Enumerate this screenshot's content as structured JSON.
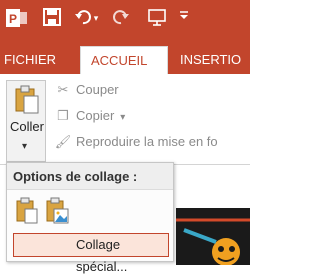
{
  "titlebar": {
    "app_logo_icon": "powerpoint-logo-icon",
    "save_icon": "save-icon",
    "undo_icon": "undo-icon",
    "undo_dropdown_icon": "chevron-down-icon",
    "redo_icon": "redo-icon",
    "presentation_icon": "start-from-beginning-icon",
    "customize_qat_icon": "customize-qat-icon"
  },
  "ribbon": {
    "tabs": [
      {
        "label": "FICHIER"
      },
      {
        "label": "ACCUEIL"
      },
      {
        "label": "INSERTIO"
      }
    ],
    "active_tab": "ACCUEIL",
    "clipboard": {
      "paste_label": "Coller",
      "cut_label": "Couper",
      "copy_label": "Copier",
      "format_painter_label": "Reproduire la mise en fo"
    }
  },
  "paste_menu": {
    "header": "Options de collage :",
    "options": [
      {
        "icon": "paste-keep-formatting-icon"
      },
      {
        "icon": "paste-as-picture-icon"
      }
    ],
    "special_label": "Collage spécial..."
  },
  "colors": {
    "accent": "#c2452c",
    "highlight": "#fbe4da"
  }
}
